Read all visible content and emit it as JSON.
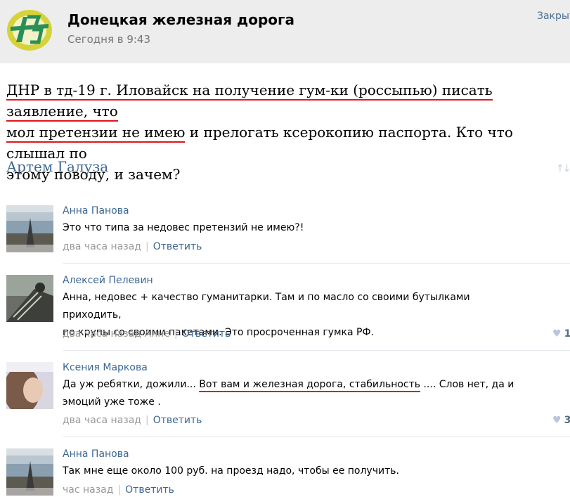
{
  "header": {
    "group_name": "Донецкая железная дорога",
    "time": "Сегодня в 9:43",
    "close": "Закрыть"
  },
  "post": {
    "text_1": "ДНР в тд-19 г. Иловайск на получение гум-ки (россыпью) писать заявление, что",
    "text_2a": "мол претензии не имею",
    "text_2b": " и прелогать ксерокопию паспорта. Кто что слышал по",
    "text_3": "этому поводу, и зачем?",
    "author": "Артем Галуза"
  },
  "icons": {
    "sort": "sort-arrows-icon",
    "like": "heart-icon"
  },
  "colors": {
    "link": "#3d6692",
    "underline": "#e0151b",
    "header_bg": "#ededed"
  },
  "comments": [
    {
      "author": "Анна Панова",
      "lines": [
        "Это что типа за недовес претензий не имею?!"
      ],
      "time": "два часа назад",
      "reply": "Ответить"
    },
    {
      "author": "Алексей Пелевин",
      "lines": [
        "Анна, недовес + качество гуманитарки. Там и по масло со своими бутылками приходить,",
        "по крупы со своими пакетами. Это просроченная гумка РФ."
      ],
      "time": "два часа назад Анне",
      "reply": "Ответить",
      "likes": "1"
    },
    {
      "author": "Ксения Маркова",
      "text_a": "Да уж ребятки, дожили... ",
      "text_b": "Вот вам и железная дорога, стабильность",
      "text_c": " .... Слов нет, да и",
      "line2": "эмоций уже тоже .",
      "time": "два часа назад",
      "reply": "Ответить",
      "likes": "3"
    },
    {
      "author": "Анна Панова",
      "lines": [
        "Так мне еще около 100 руб. на проезд надо, чтобы ее получить."
      ],
      "time": "час назад",
      "reply": "Ответить"
    }
  ]
}
